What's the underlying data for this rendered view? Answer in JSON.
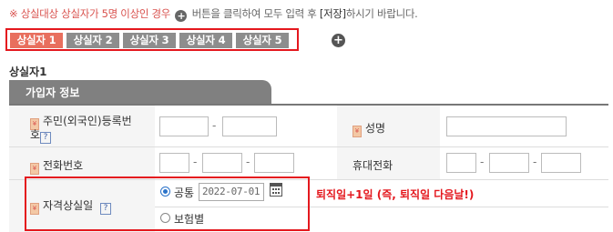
{
  "notice": {
    "prefix": "※ 상실대상 상실자가 5명 이상인 경우",
    "middle": "버튼을 클릭하여 모두 입력 후",
    "save": "[저장]",
    "suffix": "하시기 바랍니다."
  },
  "tabs": [
    "상실자 1",
    "상실자 2",
    "상실자 3",
    "상실자 4",
    "상실자 5"
  ],
  "add_label": "+",
  "section_title": "상실자1",
  "panel_header": "가입자 정보",
  "fields": {
    "rrn_label_1": "주민(외국인)등록번",
    "rrn_label_2": "호",
    "name_label": "성명",
    "phone_label": "전화번호",
    "mobile_label": "휴대전화",
    "loss_label": "자격상실일",
    "help": "?",
    "req": "¥"
  },
  "loss": {
    "option1": "공통",
    "option2": "보험별",
    "date": "2022-07-01",
    "selected": "공통",
    "note": "퇴직일+1일 (즉, 퇴직일 다음날!)"
  },
  "colors": {
    "accent_red": "#e4181e",
    "active_tab": "#e86f5e",
    "tab_gray": "#8d8d8d",
    "header_gray": "#808080"
  }
}
